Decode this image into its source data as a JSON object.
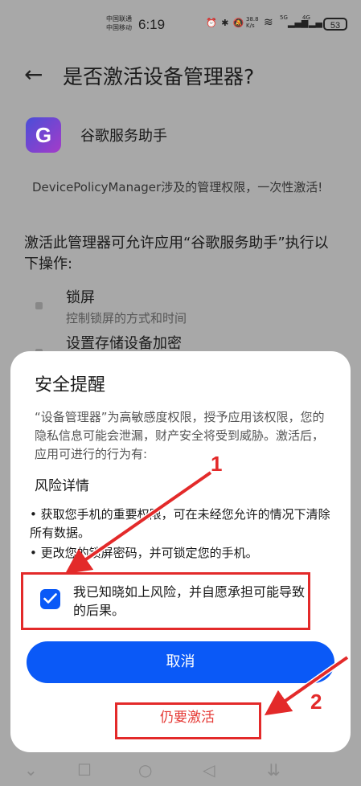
{
  "status_bar": {
    "carrier1": "中国联通",
    "carrier2": "中国移动",
    "time": "6:19",
    "net_speed_value": "38.8",
    "net_speed_unit": "K/s",
    "signal1": "5G",
    "signal2": "4G",
    "battery": "53"
  },
  "page": {
    "title": "是否激活设备管理器?",
    "app_name": "谷歌服务助手",
    "description": "DevicePolicyManager涉及的管理权限，一次性激活!",
    "allow_text": "激活此管理器可允许应用“谷歌服务助手”执行以下操作:",
    "permissions": [
      {
        "title": "锁屏",
        "subtitle": "控制锁屏的方式和时间"
      },
      {
        "title": "设置存储设备加密",
        "subtitle": ""
      }
    ]
  },
  "dialog": {
    "title": "安全提醒",
    "description": "“设备管理器”为高敏感度权限，授予应用该权限，您的隐私信息可能会泄漏，财产安全将受到威胁。激活后，应用可进行的行为有:",
    "risk_heading": "风险详情",
    "bullets": [
      "获取您手机的重要权限，可在未经您允许的情况下清除所有数据。",
      "更改您的锁屏密码，并可锁定您的手机。"
    ],
    "checkbox_label": "我已知晓如上风险，并自愿承担可能导致的后果。",
    "checkbox_checked": true,
    "cancel_label": "取消",
    "activate_label": "仍要激活"
  },
  "annotations": {
    "step1": "1",
    "step2": "2",
    "color": "#e32a2a"
  },
  "colors": {
    "accent": "#0a59f7",
    "danger": "#e53935",
    "scrim": "#a8a8a8"
  }
}
